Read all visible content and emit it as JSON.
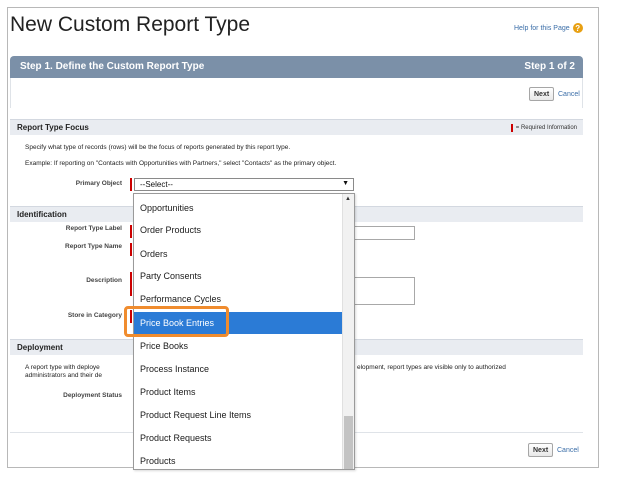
{
  "page": {
    "title": "New Custom Report Type",
    "help_link": "Help for this Page"
  },
  "step_bar": {
    "title": "Step 1. Define the Custom Report Type",
    "step_indicator": "Step 1 of 2"
  },
  "buttons": {
    "next": "Next",
    "cancel": "Cancel"
  },
  "report_type_focus": {
    "heading": "Report Type Focus",
    "required_legend": "= Required Information",
    "instruction": "Specify what type of records (rows) will be the focus of reports generated by this report type.",
    "example": "Example: If reporting on \"Contacts with Opportunities with Partners,\" select \"Contacts\" as the primary object.",
    "primary_object_label": "Primary Object",
    "primary_object_value": "--Select--"
  },
  "identification": {
    "heading": "Identification",
    "report_type_label": "Report Type Label",
    "report_type_name": "Report Type Name",
    "description": "Description",
    "store_in_category": "Store in Category"
  },
  "deployment": {
    "heading": "Deployment",
    "text_left_1": "A report type with deploye",
    "text_left_2": "administrators and their de",
    "text_right": "elopment, report types are visible only to authorized",
    "status_label": "Deployment Status"
  },
  "dropdown": {
    "items": [
      "Opportunities",
      "Order Products",
      "Orders",
      "Party Consents",
      "Performance Cycles",
      "Price Book Entries",
      "Price Books",
      "Process Instance",
      "Product Items",
      "Product Request Line Items",
      "Product Requests",
      "Products"
    ],
    "selected": "Price Book Entries"
  },
  "colors": {
    "step_bar": "#7b90a8",
    "selected_item": "#2b7bd6",
    "highlight": "#f08c2e",
    "required": "#cc0000"
  }
}
